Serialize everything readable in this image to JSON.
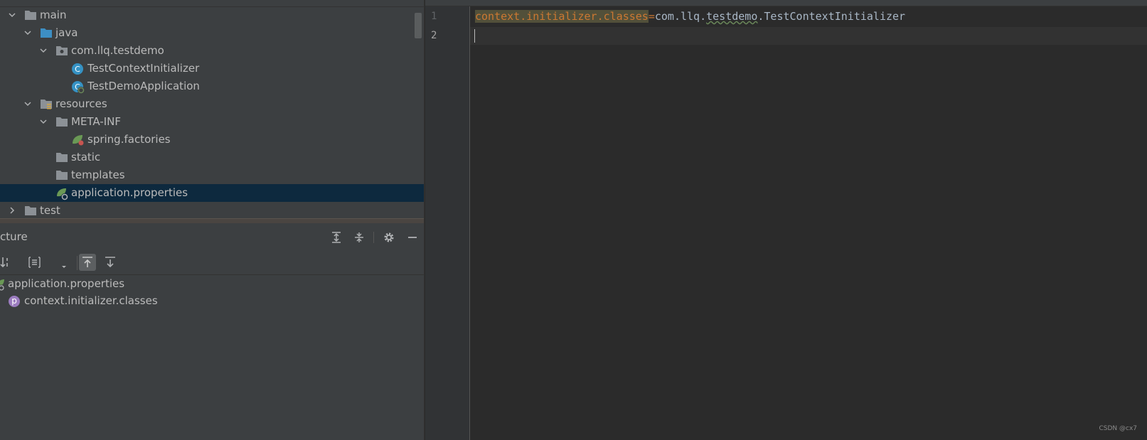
{
  "project_tree": {
    "items": [
      {
        "label": "main",
        "type": "folder",
        "expanded": true
      },
      {
        "label": "java",
        "type": "source-folder",
        "expanded": true
      },
      {
        "label": "com.llq.testdemo",
        "type": "package",
        "expanded": true
      },
      {
        "label": "TestContextInitializer",
        "type": "class"
      },
      {
        "label": "TestDemoApplication",
        "type": "spring-boot-class"
      },
      {
        "label": "resources",
        "type": "resources-folder",
        "expanded": true
      },
      {
        "label": "META-INF",
        "type": "folder",
        "expanded": true
      },
      {
        "label": "spring.factories",
        "type": "spring-file"
      },
      {
        "label": "static",
        "type": "folder"
      },
      {
        "label": "templates",
        "type": "folder"
      },
      {
        "label": "application.properties",
        "type": "spring-properties",
        "selected": true
      },
      {
        "label": "test",
        "type": "folder",
        "expanded": false
      }
    ]
  },
  "structure": {
    "title": "cture",
    "file": "application.properties",
    "property_badge": "p",
    "property": "context.initializer.classes"
  },
  "editor": {
    "line_numbers": [
      "1",
      "2"
    ],
    "key": "context.initializer.classes",
    "equals": "=",
    "value_pkg1": "com.llq.",
    "value_typo": "testdemo",
    "value_dot": ".",
    "value_class": "TestContextInitializer"
  },
  "watermark": "CSDN @cx7",
  "colors": {
    "panel_bg": "#3c3f41",
    "editor_bg": "#2b2b2b",
    "selection": "#0d293e",
    "keyword_orange": "#cc7832",
    "folder_gray": "#8c9196",
    "source_blue": "#3d8fc4"
  }
}
